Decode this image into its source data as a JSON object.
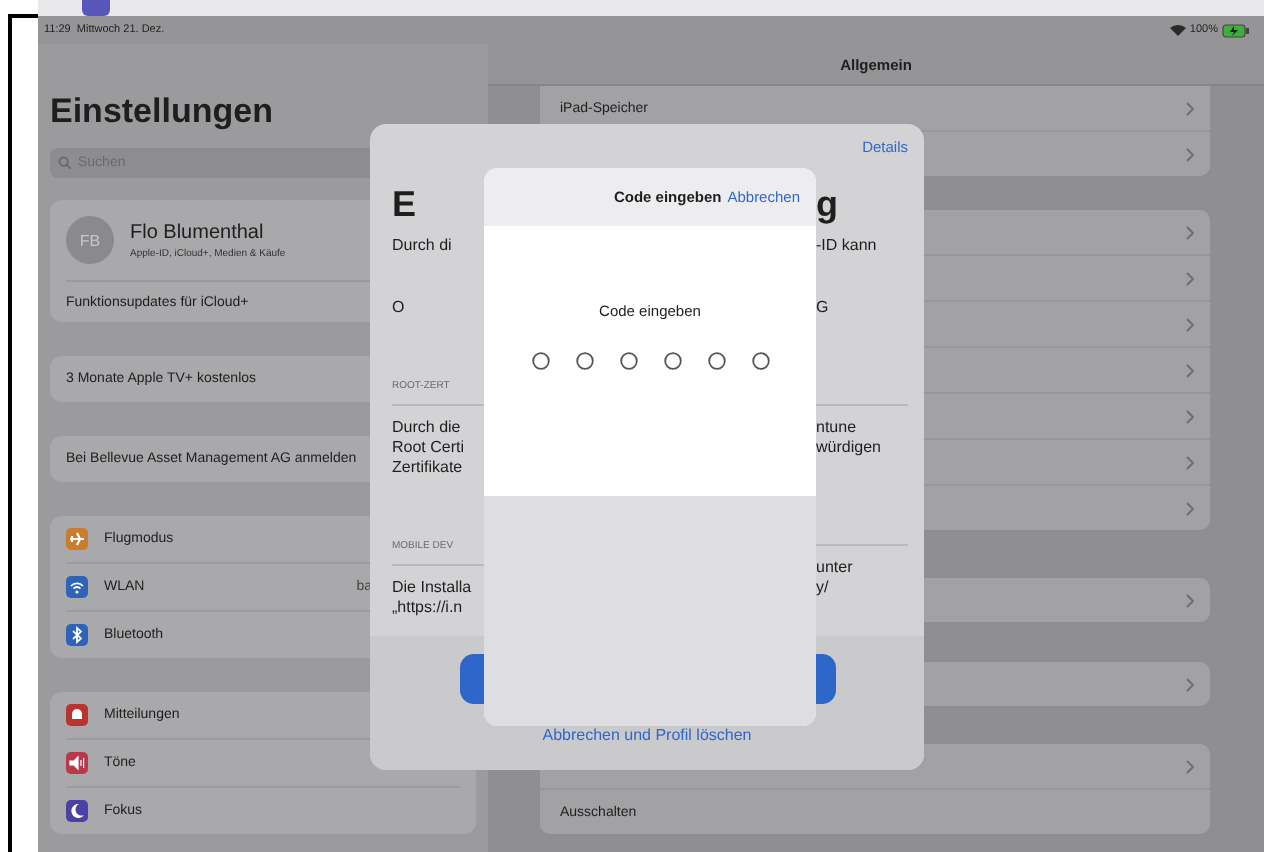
{
  "status_bar": {
    "time": "11:29",
    "date": "Mittwoch 21. Dez.",
    "battery": "100%"
  },
  "sidebar": {
    "title": "Einstellungen",
    "search": {
      "placeholder": "Suchen"
    },
    "account_card": {
      "initials": "FB",
      "name": "Flo Blumenthal",
      "subtitle": "Apple-ID, iCloud+, Medien & Käufe",
      "rows": [
        "Funktionsupdates für iCloud+"
      ]
    },
    "groups": [
      {
        "items": [
          {
            "label": "3 Monate Apple TV+ kostenlos"
          }
        ]
      },
      {
        "items": [
          {
            "label": "Bei Bellevue Asset Management AG anmelden"
          }
        ]
      },
      {
        "items": [
          {
            "label": "Flugmodus",
            "color": "#c97d2e"
          },
          {
            "label": "WLAN",
            "value": "ba",
            "color": "#2f63b8"
          },
          {
            "label": "Bluetooth",
            "color": "#2f63b8"
          }
        ]
      },
      {
        "items": [
          {
            "label": "Mitteilungen",
            "color": "#b9342f"
          },
          {
            "label": "Töne",
            "color": "#b83a4a"
          },
          {
            "label": "Fokus",
            "color": "#4b40a3"
          }
        ]
      }
    ]
  },
  "detail": {
    "title": "Allgemein",
    "groups": [
      {
        "rows": [
          {
            "label": "iPad-Speicher",
            "chevron": true
          },
          {
            "chevron": true
          }
        ]
      },
      {
        "rows": [
          {
            "chevron": true
          },
          {
            "chevron": true
          },
          {
            "chevron": true
          },
          {
            "chevron": true
          },
          {
            "chevron": true
          },
          {
            "chevron": true
          },
          {
            "chevron": true
          }
        ]
      },
      {
        "rows": [
          {
            "chevron": true
          }
        ]
      },
      {
        "rows": [
          {
            "chevron": true
          }
        ]
      },
      {
        "rows": [
          {
            "chevron": true
          },
          {
            "label": "Ausschalten",
            "chevron": false
          }
        ]
      }
    ]
  },
  "profile_sheet": {
    "details_link": "Details",
    "rows": [
      {
        "kind": "title",
        "left": [
          "E"
        ],
        "right": [
          "g"
        ]
      },
      {
        "kind": "text",
        "left": [
          "Durch di"
        ],
        "right": [
          "-ID kann"
        ]
      },
      {
        "kind": "org",
        "left": [
          "O"
        ],
        "right": [
          "G"
        ]
      },
      {
        "kind": "caption",
        "left": [
          "ROOT-ZERT"
        ]
      },
      {
        "kind": "paragraph",
        "left": [
          "Durch die",
          "Root Certi",
          "Zertifikate"
        ],
        "right": [
          "ntune",
          "würdigen"
        ]
      },
      {
        "kind": "caption",
        "left": [
          "MOBILE DEV"
        ]
      },
      {
        "kind": "paragraph",
        "left": [
          "Die Installa",
          "„https://i.n"
        ],
        "right": [
          "unter",
          "y/"
        ]
      }
    ],
    "cancel_link": "Abbrechen und Profil löschen"
  },
  "code_dialog": {
    "title": "Code eingeben",
    "cancel": "Abbrechen",
    "prompt": "Code eingeben",
    "digits": [
      {
        "filled": false
      },
      {
        "filled": false
      },
      {
        "filled": false
      },
      {
        "filled": false
      },
      {
        "filled": false
      },
      {
        "filled": false
      }
    ]
  }
}
